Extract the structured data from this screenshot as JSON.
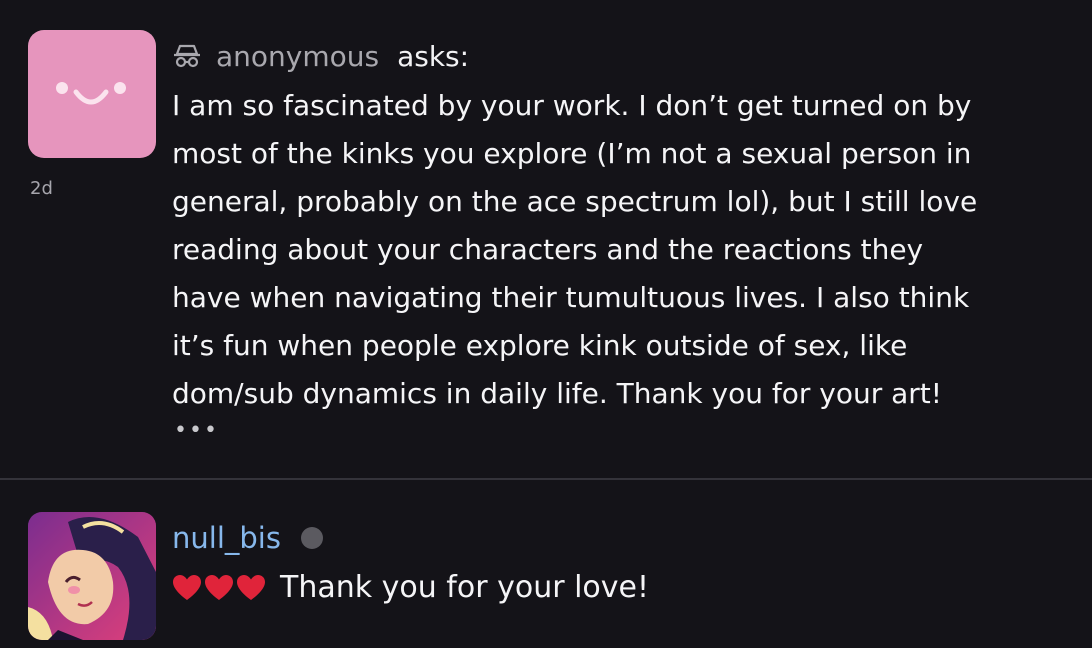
{
  "ask": {
    "author": "anonymous",
    "verb": "asks:",
    "timestamp": "2d",
    "question_lines": [
      "I am so fascinated by your work. I don’t get turned on by",
      "most of the kinks you explore (I’m not a sexual person in",
      "general, probably on the ace spectrum lol), but I still love",
      "reading about your characters and the reactions they",
      "have when navigating their tumultuous lives. I also think",
      "it’s fun when people explore kink outside of sex, like",
      "dom/sub dynamics in daily life. Thank you for your art!"
    ],
    "more": "•••"
  },
  "answer": {
    "username": "null_bis",
    "text": "Thank you for your love!"
  },
  "icons": {
    "anon": "incognito-icon",
    "heart": "red-heart-icon",
    "status": "status-dot-icon"
  },
  "colors": {
    "background": "#141318",
    "anon_avatar": "#e695bd",
    "username": "#87b8ec",
    "heart": "#e0243a",
    "divider": "#34333a"
  }
}
